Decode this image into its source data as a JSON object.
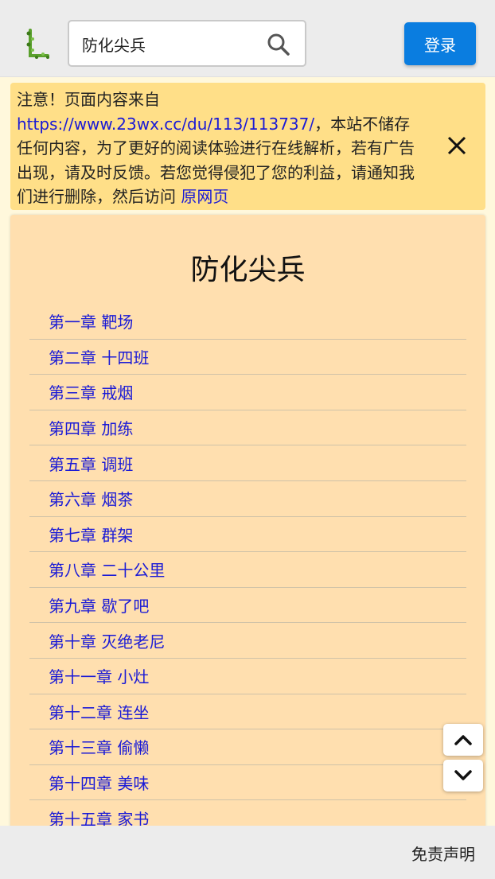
{
  "header": {
    "search_value": "防化尖兵",
    "login_label": "登录"
  },
  "notice": {
    "prefix": "注意！页面内容来自",
    "source_url": "https://www.23wx.cc/du/113/113737/",
    "middle": "，本站不储存任何内容，为了更好的阅读体验进行在线解析，若有广告出现，请及时反馈。若您觉得侵犯了您的利益，请通知我们进行删除，然后访问 ",
    "original_link": "原网页"
  },
  "book": {
    "title": "防化尖兵",
    "chapters": [
      "第一章 靶场",
      "第二章 十四班",
      "第三章 戒烟",
      "第四章 加练",
      "第五章 调班",
      "第六章 烟茶",
      "第七章 群架",
      "第八章 二十公里",
      "第九章 歇了吧",
      "第十章 灭绝老尼",
      "第十一章 小灶",
      "第十二章 连坐",
      "第十三章 偷懒",
      "第十四章 美味",
      "第十五章 家书"
    ]
  },
  "footer": {
    "disclaimer": "免责声明"
  },
  "colors": {
    "accent": "#0a7de0",
    "notice_bg": "#ffdf88",
    "card_bg": "#ffdfaf",
    "link": "#1a1ad6"
  }
}
